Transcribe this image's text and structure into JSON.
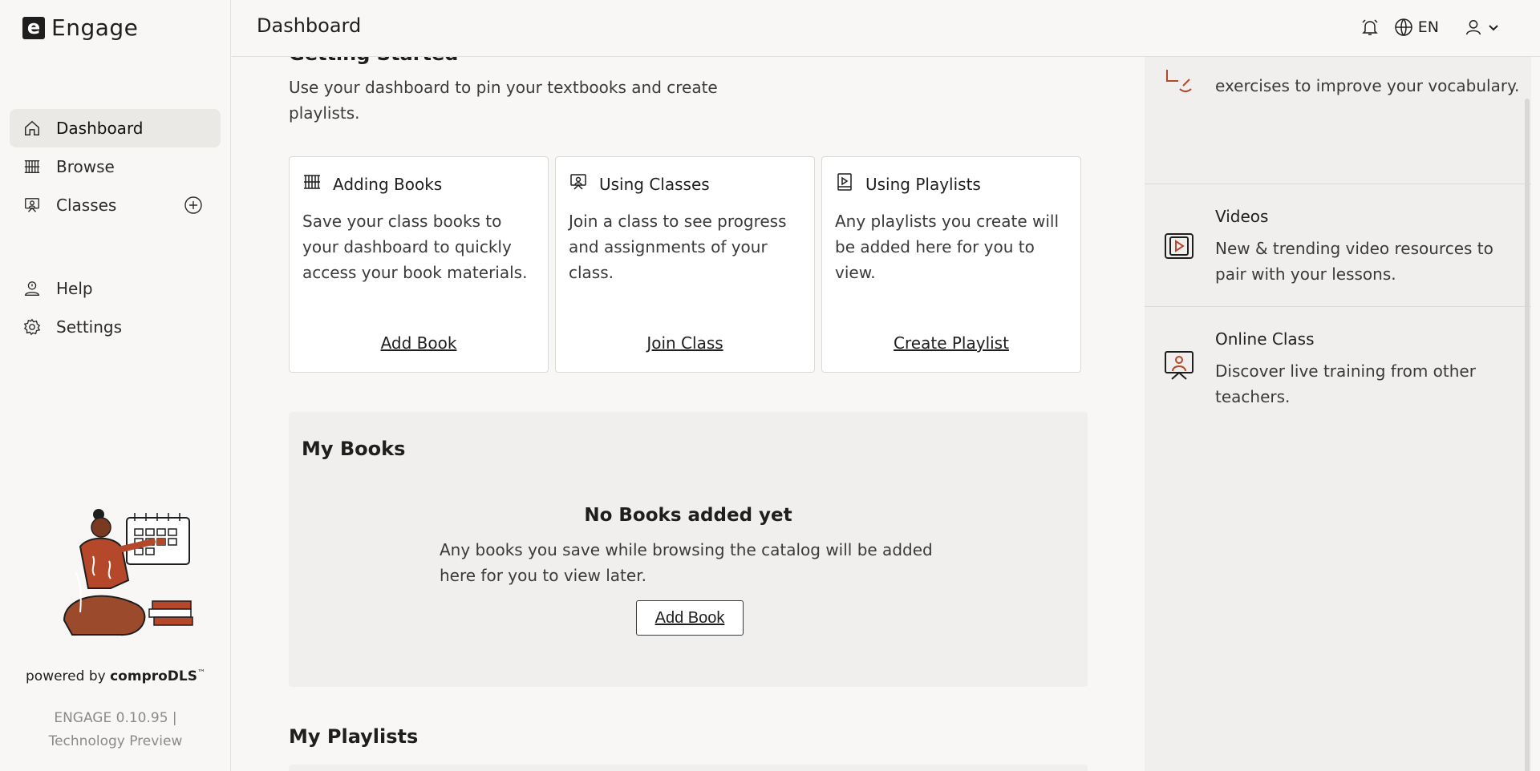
{
  "app": {
    "logo_letter": "e",
    "name": "Engage"
  },
  "sidebar": {
    "items": [
      {
        "label": "Dashboard",
        "icon": "home-icon"
      },
      {
        "label": "Browse",
        "icon": "bookshelf-icon"
      },
      {
        "label": "Classes",
        "icon": "classroom-icon"
      }
    ],
    "secondary": [
      {
        "label": "Help",
        "icon": "help-icon"
      },
      {
        "label": "Settings",
        "icon": "gear-icon"
      }
    ],
    "powered_prefix": "powered by",
    "powered_brand": "comproDLS",
    "powered_tm": "™",
    "version_line1": "ENGAGE 0.10.95 |",
    "version_line2": "Technology Preview"
  },
  "header": {
    "title": "Dashboard",
    "language": "EN"
  },
  "getting_started": {
    "title": "Getting Started",
    "description": "Use your dashboard to pin your textbooks and create playlists.",
    "cards": [
      {
        "title": "Adding Books",
        "body": "Save your class books to your dashboard to quickly access your book materials.",
        "link": "Add Book"
      },
      {
        "title": "Using Classes",
        "body": "Join a class to see progress and assignments of your class.",
        "link": "Join Class"
      },
      {
        "title": "Using Playlists",
        "body": "Any playlists you create will be added here for you to view.",
        "link": "Create Playlist"
      }
    ]
  },
  "my_books": {
    "title": "My Books",
    "empty_title": "No Books added yet",
    "empty_desc": "Any books you save while browsing the catalog will be added here for you to view later.",
    "button": "Add Book"
  },
  "my_playlists": {
    "title": "My Playlists"
  },
  "right_panel": {
    "items": [
      {
        "title": "",
        "desc": "exercises to improve your vocabulary."
      },
      {
        "title": "Videos",
        "desc": "New & trending video resources to pair with your lessons."
      },
      {
        "title": "Online Class",
        "desc": "Discover live training from other teachers."
      }
    ]
  },
  "colors": {
    "accent": "#b5482a",
    "text": "#1e1e1e",
    "bg": "#f8f7f5",
    "panel": "#f0efed"
  }
}
